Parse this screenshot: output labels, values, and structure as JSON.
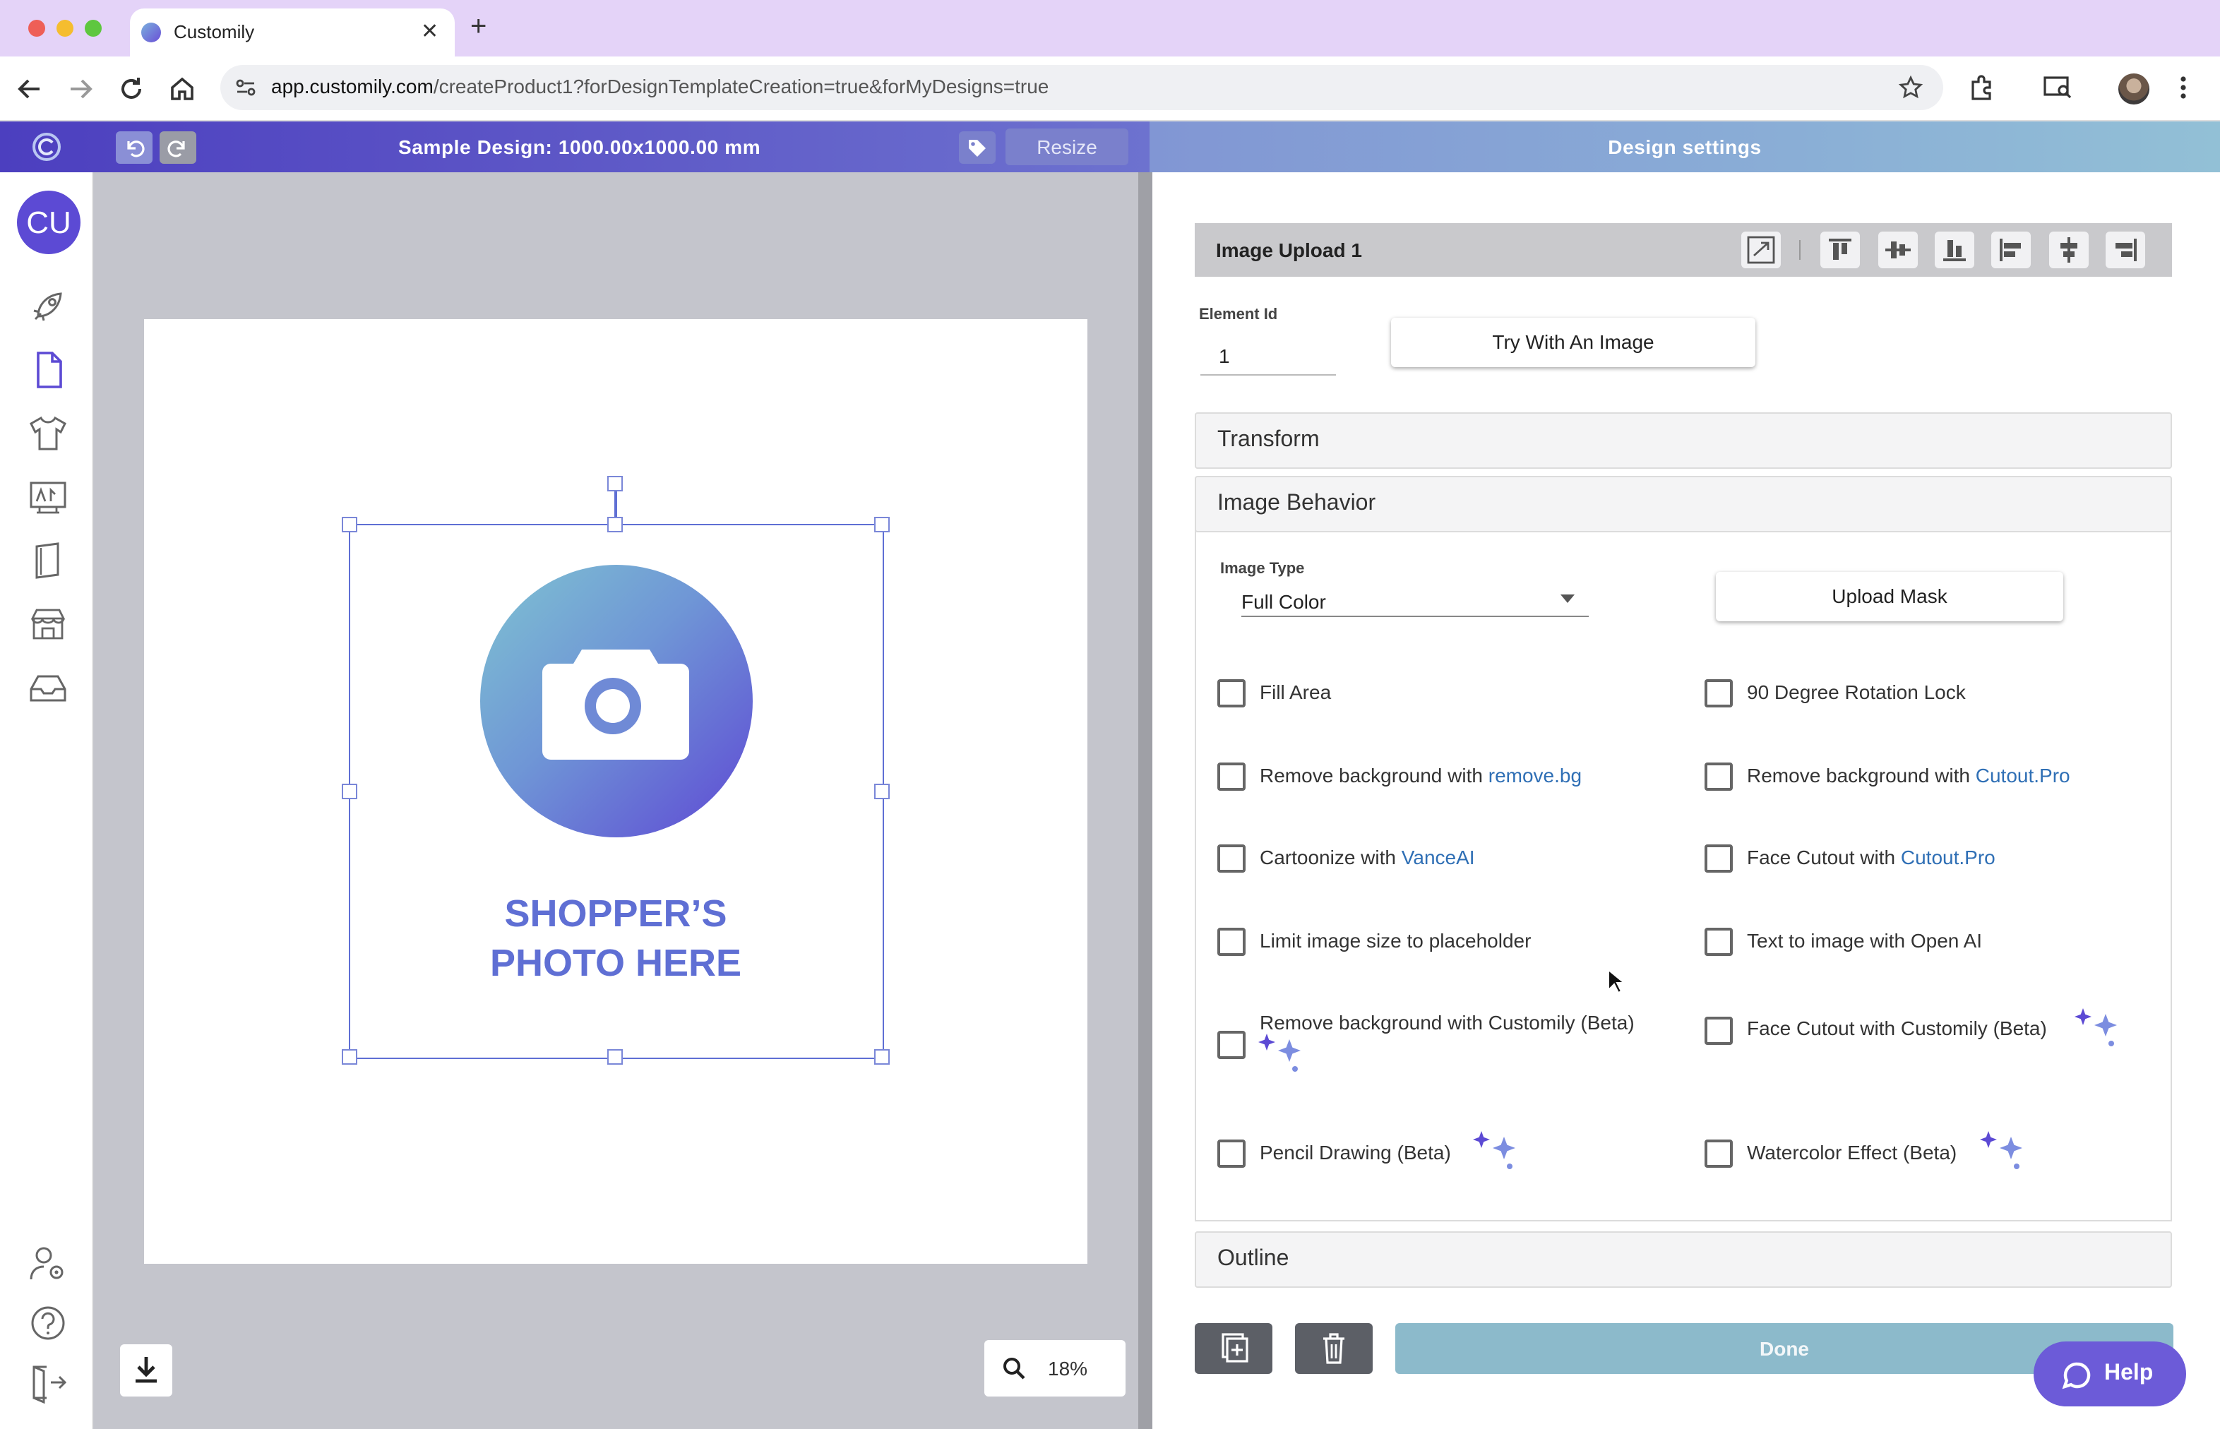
{
  "browser": {
    "tab_title": "Customily",
    "tab_close": "✕",
    "new_tab": "+",
    "url_domain": "app.customily.com",
    "url_path": "/createProduct1?forDesignTemplateCreation=true&forMyDesigns=true"
  },
  "header": {
    "design_title": "Sample Design: 1000.00x1000.00 mm",
    "resize_label": "Resize",
    "design_settings_title": "Design settings"
  },
  "sidebar": {
    "avatar_initials": "CU",
    "items": [
      "rocket-icon",
      "page-icon",
      "tshirt-icon",
      "artwork-icon",
      "book-icon",
      "store-icon",
      "inbox-icon",
      "user-settings-icon",
      "help-icon",
      "logout-icon"
    ]
  },
  "canvas": {
    "placeholder_line1": "SHOPPER’S",
    "placeholder_line2": "PHOTO HERE",
    "zoom_level": "18%",
    "accent_color": "#5f6fd4"
  },
  "element": {
    "title": "Image Upload 1",
    "element_id_label": "Element Id",
    "element_id_value": "1",
    "try_with_image_label": "Try With An Image"
  },
  "sections": {
    "transform": "Transform",
    "image_behavior": "Image Behavior",
    "outline": "Outline"
  },
  "image_behavior": {
    "image_type_label": "Image Type",
    "image_type_value": "Full Color",
    "upload_mask_label": "Upload Mask",
    "options": {
      "fill_area": "Fill Area",
      "rotation_lock": "90 Degree Rotation Lock",
      "remove_bg_prefix": "Remove background with ",
      "remove_bg_link": "remove.bg",
      "remove_bg_cutout_prefix": "Remove background with ",
      "remove_bg_cutout_link": "Cutout.Pro",
      "cartoonize_prefix": "Cartoonize with ",
      "cartoonize_link": "VanceAI",
      "face_cutout_prefix": "Face Cutout with ",
      "face_cutout_link": "Cutout.Pro",
      "limit_size": "Limit image size to placeholder",
      "text_to_image": "Text to image with Open AI",
      "remove_bg_customily": "Remove background with Customily (Beta)",
      "face_cutout_customily": "Face Cutout with Customily (Beta)",
      "pencil_drawing": "Pencil Drawing (Beta)",
      "watercolor": "Watercolor Effect (Beta)"
    }
  },
  "footer": {
    "done_label": "Done",
    "help_label": "Help"
  }
}
